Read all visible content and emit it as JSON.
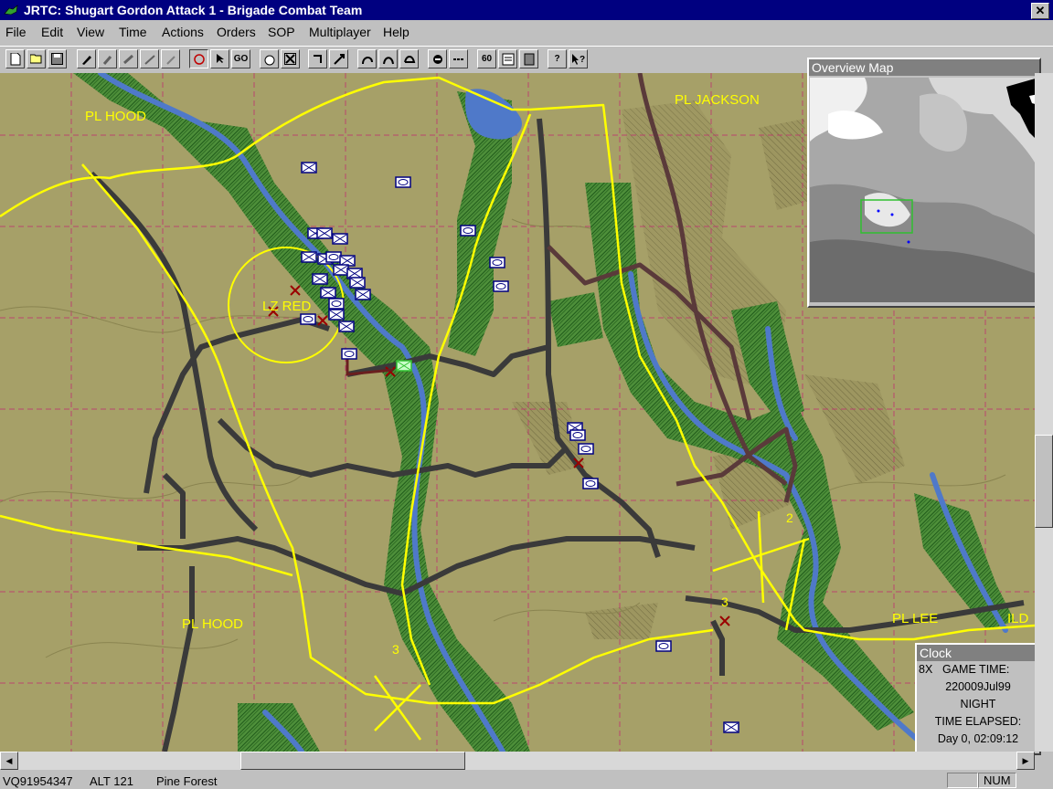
{
  "window": {
    "title": "JRTC: Shugart Gordon Attack 1 - Brigade Combat Team",
    "close": "✕"
  },
  "menu": [
    "File",
    "Edit",
    "View",
    "Time",
    "Actions",
    "Orders",
    "SOP",
    "Multiplayer",
    "Help"
  ],
  "toolbar": {
    "go_label": "GO",
    "btn_60": "60",
    "help_label": "?"
  },
  "map": {
    "labels": {
      "pl_hood_top": "PL HOOD",
      "pl_jackson": "PL JACKSON",
      "lz_red": "LZ RED",
      "pl_hood_bottom": "PL HOOD",
      "pl_lee": "PL LEE",
      "pl_cut": "ILD",
      "num_2": "2",
      "num_3_right": "3",
      "num_3_bottom": "3"
    }
  },
  "overview": {
    "title": "Overview Map"
  },
  "clock": {
    "title": "Clock",
    "speed": "8X",
    "game_time_label": "GAME TIME:",
    "game_time": "220009Jul99",
    "phase": "NIGHT",
    "elapsed_label": "TIME ELAPSED:",
    "elapsed": "Day 0, 02:09:12"
  },
  "status": {
    "grid": "VQ91954347",
    "alt": "ALT  121",
    "terrain": "Pine Forest",
    "num": "NUM"
  },
  "colors": {
    "title_bg": "#000080",
    "map_bg": "#a6a068",
    "phase_lines": "#ffff00",
    "forest_green": "#2e8a2e",
    "river": "#4f79c9"
  }
}
